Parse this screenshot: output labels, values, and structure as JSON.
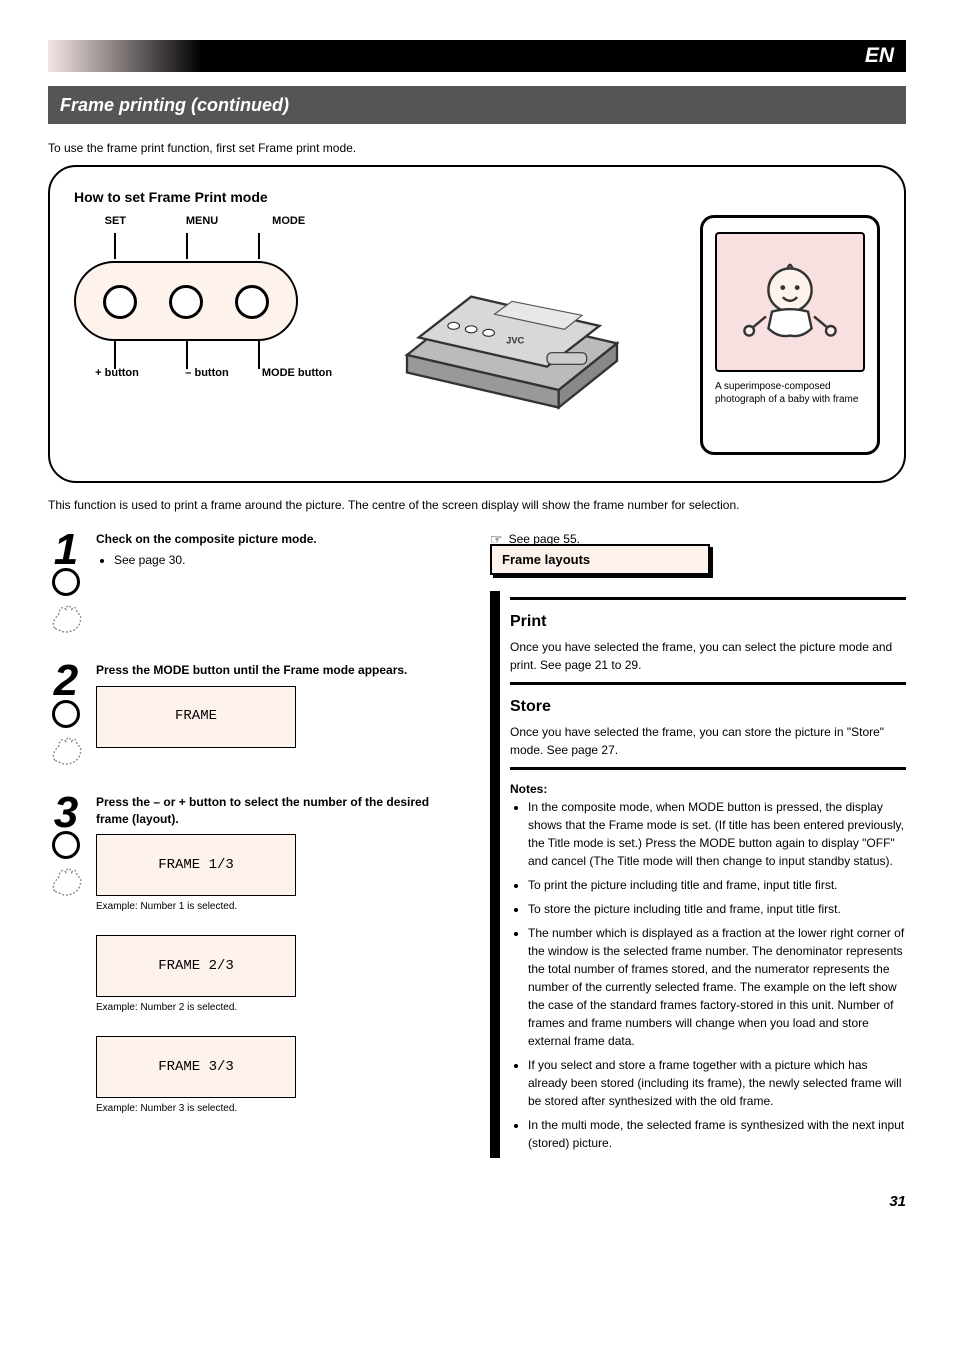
{
  "banner": {
    "title_en": "EN",
    "subtitle": "Frame printing (continued)"
  },
  "frame_intro": "To use the frame print function, first set Frame print mode.",
  "box": {
    "heading": "How to set Frame Print mode",
    "btn_top_labels": [
      "SET",
      "MENU",
      "MODE"
    ],
    "btn_bottom_labels": [
      "+ button",
      "– button",
      "MODE button"
    ],
    "photo_caption": "A superimpose-composed photograph of a baby with frame"
  },
  "purpose": "This function is used to print a frame around the picture. The centre of the screen display will show the frame number for selection.",
  "steps": {
    "s1": {
      "title": "Check on the composite picture mode.",
      "bullets": [
        "See page 30."
      ]
    },
    "s2": {
      "title": "Press the MODE button until the Frame mode appears.",
      "lcd": "FRAME"
    },
    "s3": {
      "title": "Press the – or + button to select the number of the desired frame (layout).",
      "items": [
        {
          "lcd": "FRAME 1/3",
          "caption": "Example: Number 1 is selected."
        },
        {
          "lcd": "FRAME 2/3",
          "caption": "Example: Number 2 is selected."
        },
        {
          "lcd": "FRAME 3/3",
          "caption": "Example: Number 3 is selected."
        }
      ]
    }
  },
  "right": {
    "see_page": "See page 55.",
    "layouts_title": "Frame layouts",
    "print_title": "Print",
    "print_body": "Once you have selected the frame, you can select the picture mode and print. See page 21 to 29.",
    "store_title": "Store",
    "store_body": "Once you have selected the frame, you can store the picture in \"Store\" mode. See page 27.",
    "notes_title": "Notes:",
    "notes": [
      "In the composite mode, when MODE button is pressed, the display shows that the Frame mode is set. (If title has been entered previously, the Title mode is set.) Press the MODE button again to display \"OFF\" and cancel (The Title mode will then change to input standby status).",
      "To print the picture including title and frame, input title first.",
      "To store the picture including title and frame, input title first.",
      "The number which is displayed as a fraction at the lower right corner of the window is the selected frame number. The denominator represents the total number of frames stored, and the numerator represents the number of the currently selected frame. The example on the left show the case of the standard frames factory-stored in this unit. Number of frames and frame numbers will change when you load and store external frame data.",
      "If you select and store a frame together with a picture which has already been stored (including its frame), the newly selected frame will be stored after synthesized with the old frame.",
      "In the multi mode, the selected frame is synthesized with the next input (stored) picture."
    ]
  },
  "page_number": "31"
}
